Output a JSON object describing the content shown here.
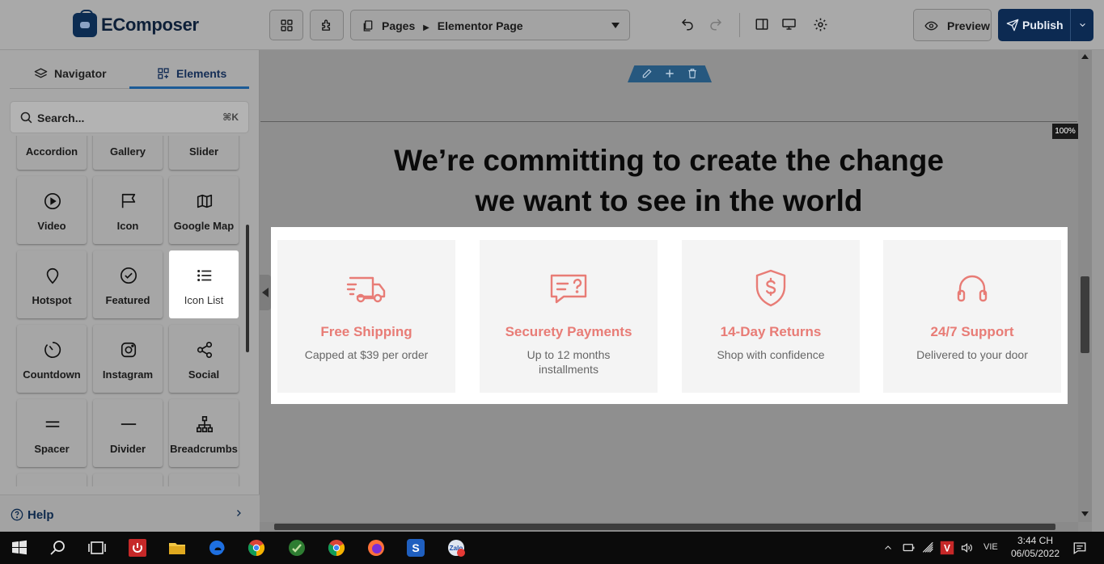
{
  "app": {
    "brand": "EComposer",
    "colors": {
      "navy": "#0c2a52",
      "accent_link": "#1c5b96",
      "card_accent": "#e87c76",
      "white": "#ffffff"
    }
  },
  "sidebar": {
    "tabs": [
      {
        "label": "Navigator",
        "icon": "layers-icon"
      },
      {
        "label": "Elements",
        "icon": "grid-plus-icon",
        "active": true
      }
    ],
    "search": {
      "placeholder": "Search...",
      "shortcut": "⌘K"
    },
    "elements": [
      {
        "label": "Accordion",
        "icon": "accordion-icon"
      },
      {
        "label": "Gallery",
        "icon": "gallery-icon"
      },
      {
        "label": "Slider",
        "icon": "slider-icon"
      },
      {
        "label": "Video",
        "icon": "play-circle-icon"
      },
      {
        "label": "Icon",
        "icon": "flag-icon"
      },
      {
        "label": "Google Map",
        "icon": "map-icon"
      },
      {
        "label": "Hotspot",
        "icon": "map-pin-icon"
      },
      {
        "label": "Featured",
        "icon": "check-circle-icon"
      },
      {
        "label": "Icon List",
        "icon": "list-icon",
        "active": true
      },
      {
        "label": "Countdown",
        "icon": "timer-icon"
      },
      {
        "label": "Instagram",
        "icon": "instagram-icon"
      },
      {
        "label": "Social",
        "icon": "share-icon"
      },
      {
        "label": "Spacer",
        "icon": "spacer-icon"
      },
      {
        "label": "Divider",
        "icon": "divider-icon"
      },
      {
        "label": "Breadcrumbs",
        "icon": "sitemap-icon"
      }
    ],
    "help": "Help"
  },
  "toolbar": {
    "page_type": "Pages",
    "page_name": "Elementor Page",
    "preview": "Preview",
    "publish": "Publish"
  },
  "canvas": {
    "zoom": "100%",
    "headline": [
      "We’re committing to create the change",
      "we want to see in the world"
    ],
    "features": [
      {
        "title": "Free Shipping",
        "desc": "Capped at $39 per order",
        "icon": "truck-icon"
      },
      {
        "title": "Securety Payments",
        "desc": "Up to 12 months installments",
        "icon": "chat-question-icon"
      },
      {
        "title": "14-Day Returns",
        "desc": "Shop with confidence",
        "icon": "shield-dollar-icon"
      },
      {
        "title": "24/7 Support",
        "desc": "Delivered to your door",
        "icon": "headphones-icon"
      }
    ]
  },
  "taskbar": {
    "language": "VIE",
    "time": "3:44 CH",
    "date": "06/05/2022"
  }
}
